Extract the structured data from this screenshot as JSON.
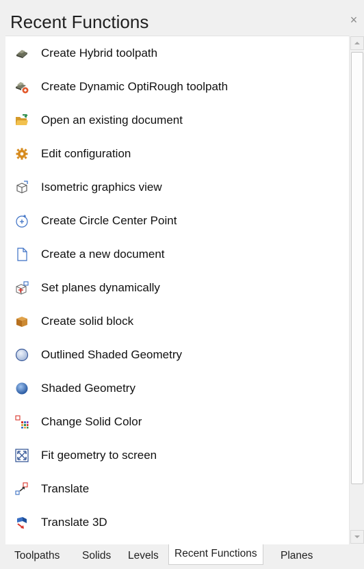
{
  "panel": {
    "title": "Recent Functions",
    "close_glyph": "×"
  },
  "items": [
    {
      "label": "Create Hybrid toolpath",
      "icon": "hybrid-toolpath-icon"
    },
    {
      "label": "Create Dynamic OptiRough toolpath",
      "icon": "optirough-toolpath-icon"
    },
    {
      "label": "Open an existing document",
      "icon": "open-folder-icon"
    },
    {
      "label": "Edit configuration",
      "icon": "gear-icon"
    },
    {
      "label": "Isometric graphics view",
      "icon": "isometric-cube-icon"
    },
    {
      "label": "Create Circle Center Point",
      "icon": "circle-center-point-icon"
    },
    {
      "label": "Create a new document",
      "icon": "new-document-icon"
    },
    {
      "label": "Set planes dynamically",
      "icon": "dynamic-planes-icon"
    },
    {
      "label": "Create solid block",
      "icon": "solid-block-icon"
    },
    {
      "label": "Outlined Shaded Geometry",
      "icon": "outlined-shaded-sphere-icon"
    },
    {
      "label": "Shaded Geometry",
      "icon": "shaded-sphere-icon"
    },
    {
      "label": "Change Solid Color",
      "icon": "color-grid-icon"
    },
    {
      "label": "Fit geometry to screen",
      "icon": "fit-screen-icon"
    },
    {
      "label": "Translate",
      "icon": "translate-icon"
    },
    {
      "label": "Translate 3D",
      "icon": "translate-3d-icon"
    }
  ],
  "tabs": [
    {
      "label": "Toolpaths"
    },
    {
      "label": "Solids"
    },
    {
      "label": "Levels"
    },
    {
      "label": "Recent Functions",
      "active": true
    },
    {
      "label": "Planes"
    }
  ],
  "colors": {
    "background": "#f0f0f0",
    "list_background": "#ffffff",
    "text": "#111111"
  }
}
